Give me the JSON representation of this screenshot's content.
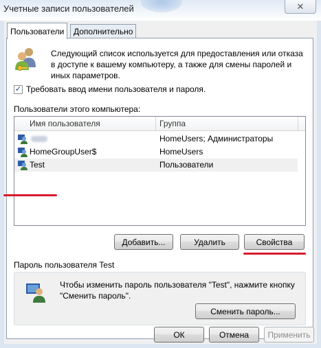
{
  "window": {
    "title": "Учетные записи пользователей",
    "close_symbol": "✕"
  },
  "tabs": [
    {
      "label": "Пользователи",
      "active": true
    },
    {
      "label": "Дополнительно",
      "active": false
    }
  ],
  "users_tab": {
    "intro_text": "Следующий список используется для предоставления или отказа в доступе к вашему компьютеру, а также для смены паролей и иных параметров.",
    "require_login": {
      "label": "Требовать ввод имени пользователя и пароля.",
      "checked": true,
      "check_mark": "✓"
    },
    "list_caption": "Пользователи этого компьютера:",
    "columns": [
      "Имя пользователя",
      "Группа"
    ],
    "rows": [
      {
        "name": "",
        "name_obscured": true,
        "group": "HomeUsers; Администраторы"
      },
      {
        "name": "HomeGroupUser$",
        "group": "HomeUsers"
      },
      {
        "name": "Test",
        "group": "Пользователи",
        "selected": true
      }
    ],
    "buttons": {
      "add": "Добавить...",
      "remove": "Удалить",
      "properties": "Свойства"
    },
    "password_group": {
      "title": "Пароль пользователя Test",
      "text": "Чтобы изменить пароль пользователя \"Test\", нажмите кнопку \"Сменить пароль\".",
      "change_button": "Сменить пароль..."
    }
  },
  "dialog_buttons": {
    "ok": "ОК",
    "cancel": "Отмена",
    "apply": "Применить",
    "apply_enabled": false
  },
  "annotations": {
    "underline_color": "#d71a2a",
    "underlined": [
      "Test row",
      "Свойства button"
    ]
  }
}
